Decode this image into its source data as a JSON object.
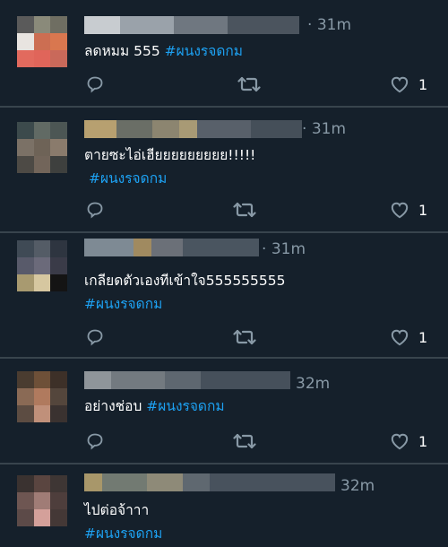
{
  "tweets": [
    {
      "time": "31m",
      "text": "ลดหมม 555",
      "hashtag": "#ผนงรจดกม",
      "likes": "1"
    },
    {
      "time": "31m",
      "text": "ตายซะไอ่เฮียยยยยยยยย!!!!!",
      "hashtag": "#ผนงรจดกม",
      "likes": "1"
    },
    {
      "time": "31m",
      "text": "เกลียดตัวเองทีเข้าใจ555555555",
      "hashtag": "#ผนงรจดกม",
      "likes": "1"
    },
    {
      "time": "32m",
      "text": "อย่างช่อบ",
      "hashtag": "#ผนงรจดกม",
      "likes": "1"
    },
    {
      "time": "32m",
      "text": "ไปต่อจ้าาา",
      "hashtag": "#ผนงรจดกม"
    }
  ],
  "icons": {
    "reply": "reply-icon",
    "retweet": "retweet-icon",
    "like": "heart-icon"
  },
  "colors": {
    "background": "#15202b",
    "divider": "#38444d",
    "hashtag": "#1da1f2",
    "muted": "#8899a6"
  }
}
